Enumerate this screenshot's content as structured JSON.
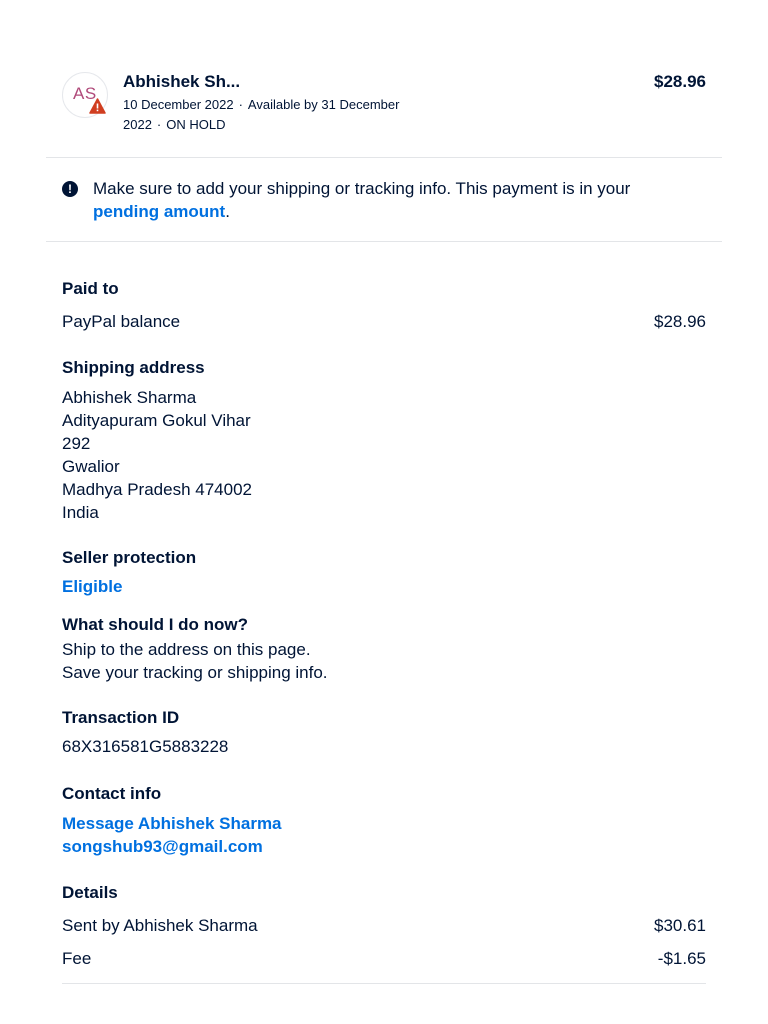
{
  "header": {
    "avatar_initials": "AS",
    "name": "Abhishek Sh...",
    "amount": "$28.96",
    "date": "10 December 2022",
    "available": "Available by 31 December 2022",
    "status": "ON HOLD"
  },
  "alert": {
    "text": "Make sure to add your shipping or tracking info. This payment is in your ",
    "link": "pending amount",
    "suffix": "."
  },
  "paid_to": {
    "label": "Paid to",
    "account": "PayPal balance",
    "amount": "$28.96"
  },
  "shipping": {
    "label": "Shipping address",
    "lines": [
      "Abhishek Sharma",
      "Adityapuram Gokul Vihar",
      "292",
      "Gwalior",
      "Madhya Pradesh 474002",
      "India"
    ]
  },
  "seller_protection": {
    "label": "Seller protection",
    "value": "Eligible"
  },
  "next_steps": {
    "label": "What should I do now?",
    "lines": [
      "Ship to the address on this page.",
      "Save your tracking or shipping info."
    ]
  },
  "transaction": {
    "label": "Transaction ID",
    "id": "68X316581G5883228"
  },
  "contact": {
    "label": "Contact info",
    "message_link": "Message Abhishek Sharma",
    "email": "songshub93@gmail.com"
  },
  "details": {
    "label": "Details",
    "rows": [
      {
        "label": "Sent by Abhishek Sharma",
        "value": "$30.61"
      },
      {
        "label": "Fee",
        "value": "-$1.65"
      }
    ]
  },
  "colors": {
    "text": "#001435",
    "link": "#0070e0",
    "warning": "#d03e20",
    "divider": "#e3e5e8"
  }
}
